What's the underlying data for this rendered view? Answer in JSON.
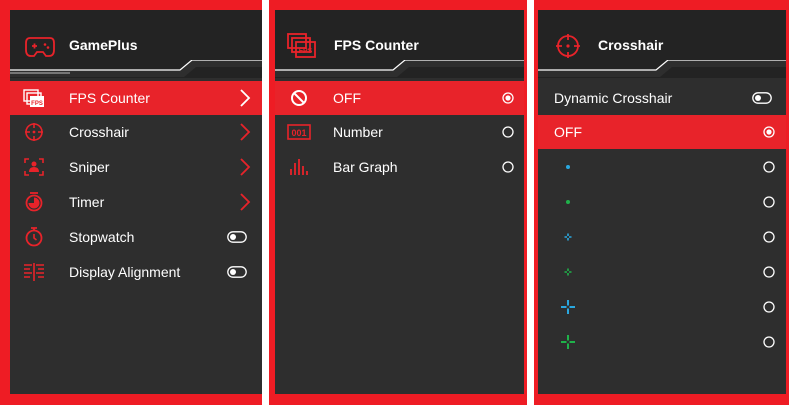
{
  "colors": {
    "accent": "#e8232a",
    "frame": "#ee1c24",
    "panel": "#2e2e2e",
    "header": "#232323",
    "blue": "#29a8e0",
    "green": "#1fb24a"
  },
  "panels": {
    "gameplus": {
      "title": "GamePlus",
      "icon": "gamepad-icon",
      "items": [
        {
          "label": "FPS Counter",
          "icon": "fps-icon",
          "selected": true,
          "control": "chevron"
        },
        {
          "label": "Crosshair",
          "icon": "crosshair-icon",
          "selected": false,
          "control": "chevron"
        },
        {
          "label": "Sniper",
          "icon": "sniper-icon",
          "selected": false,
          "control": "chevron"
        },
        {
          "label": "Timer",
          "icon": "timer-icon",
          "selected": false,
          "control": "chevron"
        },
        {
          "label": "Stopwatch",
          "icon": "stopwatch-icon",
          "selected": false,
          "control": "toggle",
          "toggle_on": false
        },
        {
          "label": "Display Alignment",
          "icon": "display-alignment-icon",
          "selected": false,
          "control": "toggle",
          "toggle_on": false
        }
      ]
    },
    "fps": {
      "title": "FPS Counter",
      "icon": "fps-icon",
      "options": [
        {
          "label": "OFF",
          "icon": "off-icon",
          "checked": true
        },
        {
          "label": "Number",
          "icon": "number-icon",
          "checked": false
        },
        {
          "label": "Bar Graph",
          "icon": "bar-graph-icon",
          "checked": false
        }
      ]
    },
    "crosshair": {
      "title": "Crosshair",
      "icon": "crosshair-icon",
      "toggle_item": {
        "label": "Dynamic Crosshair",
        "toggle_on": false
      },
      "options": [
        {
          "label": "OFF",
          "checked": true
        },
        {
          "label": "",
          "style": "dot",
          "color": "blue",
          "checked": false
        },
        {
          "label": "",
          "style": "dot",
          "color": "green",
          "checked": false
        },
        {
          "label": "",
          "style": "small-cross",
          "color": "blue",
          "checked": false
        },
        {
          "label": "",
          "style": "small-cross",
          "color": "green",
          "checked": false
        },
        {
          "label": "",
          "style": "large-cross",
          "color": "blue",
          "checked": false
        },
        {
          "label": "",
          "style": "large-cross",
          "color": "green",
          "checked": false
        }
      ]
    }
  }
}
